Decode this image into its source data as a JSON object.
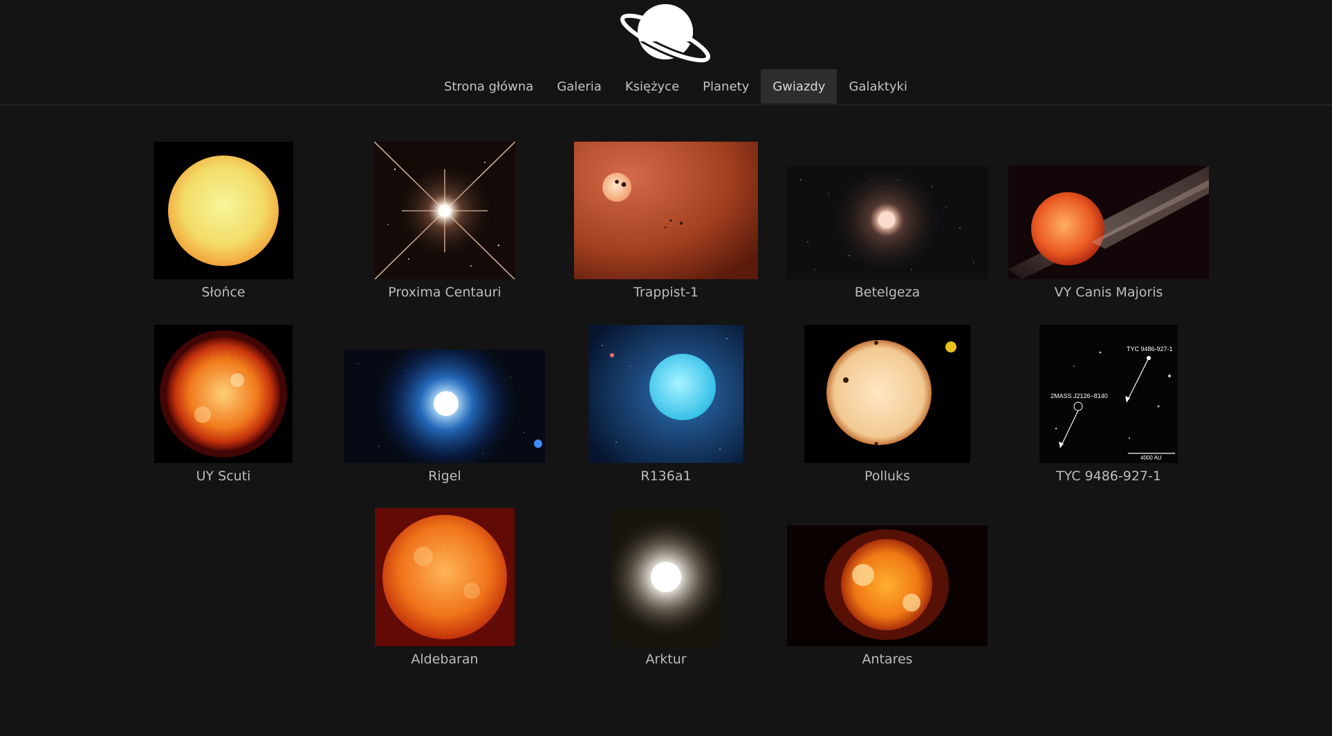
{
  "logo": {
    "icon": "saturn-icon",
    "color": "#ffffff"
  },
  "nav": [
    {
      "label": "Strona główna",
      "active": false
    },
    {
      "label": "Galeria",
      "active": false
    },
    {
      "label": "Księżyce",
      "active": false
    },
    {
      "label": "Planety",
      "active": false
    },
    {
      "label": "Gwiazdy",
      "active": true
    },
    {
      "label": "Galaktyki",
      "active": false
    }
  ],
  "stars": [
    {
      "name": "Słońce"
    },
    {
      "name": "Proxima Centauri"
    },
    {
      "name": "Trappist-1"
    },
    {
      "name": "Betelgeza"
    },
    {
      "name": "VY Canis Majoris"
    },
    {
      "name": "UY Scuti"
    },
    {
      "name": "Rigel"
    },
    {
      "name": "R136a1"
    },
    {
      "name": "Polluks"
    },
    {
      "name": "TYC 9486-927-1",
      "annotations": [
        "TYC 9486-927-1",
        "2MASS J2126−8140",
        "4000 AU"
      ]
    },
    {
      "name": "Aldebaran"
    },
    {
      "name": "Arktur"
    },
    {
      "name": "Antares"
    }
  ],
  "colors": {
    "background": "#141414",
    "nav_active": "#2e2e2e",
    "text": "#bdbdbd"
  }
}
